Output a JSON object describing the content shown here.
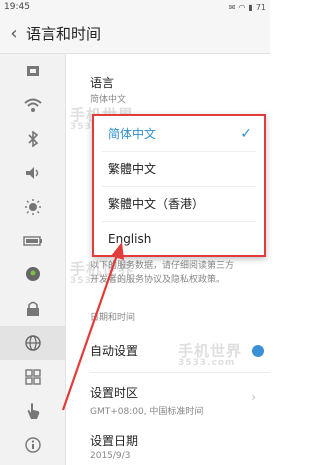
{
  "status_bar": {
    "time": "19:45",
    "battery": "71"
  },
  "header": {
    "title": "语言和时间"
  },
  "language": {
    "label": "语言",
    "value": "简体中文"
  },
  "language_menu": {
    "options": [
      "简体中文",
      "繁體中文",
      "繁體中文（香港）",
      "English"
    ],
    "selected": "简体中文"
  },
  "privacy": {
    "line1": "以下的服务数据，请仔细阅读第三方",
    "line2": "开发者的服务协议及隐私权政策。"
  },
  "datetime": {
    "section": "日期和时间",
    "auto_label": "自动设置"
  },
  "timezone": {
    "label": "设置时区",
    "value": "GMT+08:00, 中国标准时间"
  },
  "date": {
    "label": "设置日期",
    "value": "2015/9/3"
  },
  "watermark": {
    "text": "手机世界",
    "num": "3533.com"
  },
  "colors": {
    "accent": "#2f8fd0",
    "highlight_red": "#e33a3a"
  },
  "sidebar_icons": [
    "sim-icon",
    "wifi-icon",
    "bluetooth-icon",
    "sound-icon",
    "brightness-icon",
    "battery-icon",
    "location-icon",
    "lock-icon",
    "globe-icon",
    "apps-grid-icon",
    "hand-icon",
    "info-icon"
  ]
}
